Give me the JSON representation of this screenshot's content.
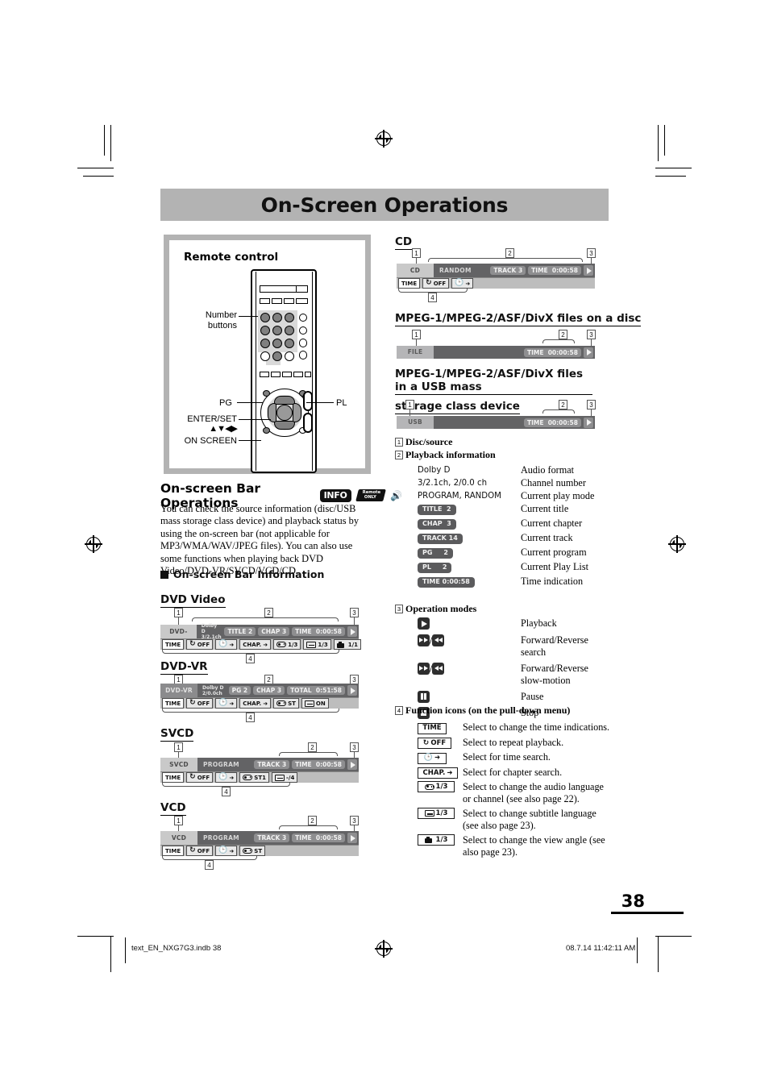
{
  "page": {
    "title": "On-Screen Operations",
    "number": "38",
    "footer_left": "text_EN_NXG7G3.indb   38",
    "footer_right": "08.7.14   11:42:11 AM"
  },
  "remote_panel": {
    "title": "Remote control",
    "labels": {
      "number_buttons_line1": "Number",
      "number_buttons_line2": "buttons",
      "pg": "PG",
      "pl": "PL",
      "enter_set": "ENTER/SET",
      "arrows": "▲▼◀▶",
      "on_screen": "ON SCREEN"
    }
  },
  "osb_section": {
    "heading": "On-screen Bar Operations",
    "badge_info": "INFO",
    "badge_remote_line1": "Remote",
    "badge_remote_line2": "ONLY",
    "body": "You can check the source information (disc/USB mass storage class device) and playback status by using the on-screen bar (not applicable for MP3/WMA/WAV/JPEG files). You can also use some functions when playing back DVD Video/DVD-VR/SVCD/VCD/CD.",
    "info_heading": "On-screen Bar Information"
  },
  "bars": {
    "dvd_video": {
      "heading": "DVD Video",
      "source": "DVD-VIDEO",
      "audio_line1": "Dolby D",
      "audio_line2": "3/2.1ch",
      "pills": [
        "TITLE  2",
        "CHAP  3"
      ],
      "time_label": "TIME",
      "time_value": "0:00:58",
      "functions": [
        "TIME",
        "OFF",
        "",
        "CHAP.",
        "1/3",
        "1/3",
        "1/1"
      ],
      "callouts": [
        "1",
        "2",
        "3",
        "4"
      ]
    },
    "dvd_vr": {
      "heading": "DVD-VR",
      "source": "DVD-VR",
      "audio_line1": "Dolby D",
      "audio_line2": "2/0.0ch",
      "pills": [
        "PG     2",
        "CHAP  3"
      ],
      "time_label": "TOTAL",
      "time_value": "0:51:58",
      "functions": [
        "TIME",
        "OFF",
        "",
        "CHAP.",
        "ST",
        "ON"
      ],
      "callouts": [
        "1",
        "2",
        "3",
        "4"
      ]
    },
    "svcd": {
      "heading": "SVCD",
      "source": "SVCD",
      "mode": "PROGRAM",
      "pills": [
        "TRACK  3"
      ],
      "time_label": "TIME",
      "time_value": "0:00:58",
      "functions": [
        "TIME",
        "OFF",
        "",
        "ST1",
        "-/4"
      ],
      "callouts": [
        "1",
        "2",
        "3",
        "4"
      ]
    },
    "vcd": {
      "heading": "VCD",
      "source": "VCD",
      "mode": "PROGRAM",
      "pills": [
        "TRACK  3"
      ],
      "time_label": "TIME",
      "time_value": "0:00:58",
      "functions": [
        "TIME",
        "OFF",
        "",
        "ST"
      ],
      "callouts": [
        "1",
        "2",
        "3",
        "4"
      ]
    },
    "cd": {
      "heading": "CD",
      "source": "CD",
      "mode": "RANDOM",
      "pills": [
        "TRACK  3"
      ],
      "time_label": "TIME",
      "time_value": "0:00:58",
      "functions": [
        "TIME",
        "OFF",
        ""
      ],
      "callouts": [
        "1",
        "2",
        "3",
        "4"
      ]
    },
    "file_disc": {
      "heading": "MPEG-1/MPEG-2/ASF/DivX files on a disc",
      "source": "FILE",
      "time_label": "TIME",
      "time_value": "00:00:58",
      "callouts": [
        "1",
        "2",
        "3"
      ]
    },
    "file_usb": {
      "heading_line1": "MPEG-1/MPEG-2/ASF/DivX files in a USB mass",
      "heading_line2": "storage class device",
      "source": "USB",
      "time_label": "TIME",
      "time_value": "00:00:58",
      "callouts": [
        "1",
        "2",
        "3"
      ]
    }
  },
  "legend": {
    "disc_source": {
      "num": "1",
      "label": "Disc/source"
    },
    "playback_info": {
      "num": "2",
      "label": "Playback information",
      "rows": [
        {
          "left": "Dolby D",
          "kind": "text",
          "right": "Audio format"
        },
        {
          "left": "3/2.1ch, 2/0.0 ch",
          "kind": "text",
          "right": "Channel number"
        },
        {
          "left": "PROGRAM, RANDOM",
          "kind": "text",
          "right": "Current play mode"
        },
        {
          "left": "TITLE  2",
          "kind": "pill",
          "right": "Current title"
        },
        {
          "left": "CHAP  3",
          "kind": "pill",
          "right": "Current chapter"
        },
        {
          "left": "TRACK 14",
          "kind": "pill",
          "right": "Current track"
        },
        {
          "left": "PG     2",
          "kind": "pill",
          "right": "Current program"
        },
        {
          "left": "PL     2",
          "kind": "pill",
          "right": "Current Play List"
        },
        {
          "left": "TIME 0:00:58",
          "kind": "pill",
          "right": "Time indication"
        }
      ]
    },
    "operation_modes": {
      "num": "3",
      "label": "Operation modes",
      "rows": [
        {
          "icon": "play-icon",
          "right": "Playback"
        },
        {
          "icon": "fast-forward-rewind-icon",
          "right": "Forward/Reverse search"
        },
        {
          "icon": "slow-forward-rewind-icon",
          "right": "Forward/Reverse slow-motion"
        },
        {
          "icon": "pause-icon",
          "right": "Pause"
        },
        {
          "icon": "stop-icon",
          "right": "Stop"
        }
      ]
    },
    "function_icons": {
      "num": "4",
      "label": "Function icons (on the pull-down menu)",
      "rows": [
        {
          "icon": "time-icon",
          "text": "TIME",
          "right": "Select to change the time indications."
        },
        {
          "icon": "repeat-icon",
          "text": "OFF",
          "right": "Select to repeat playback."
        },
        {
          "icon": "time-search-icon",
          "text": "",
          "right": "Select for time search."
        },
        {
          "icon": "chapter-search-icon",
          "text": "CHAP.",
          "right": "Select for chapter search."
        },
        {
          "icon": "audio-language-icon",
          "text": "1/3",
          "right": "Select to change the audio language or channel (see also page 22)."
        },
        {
          "icon": "subtitle-icon",
          "text": "1/3",
          "right": "Select to change subtitle language (see also page 23)."
        },
        {
          "icon": "view-angle-icon",
          "text": "1/3",
          "right": "Select to change the view angle (see also page 23)."
        }
      ]
    }
  }
}
